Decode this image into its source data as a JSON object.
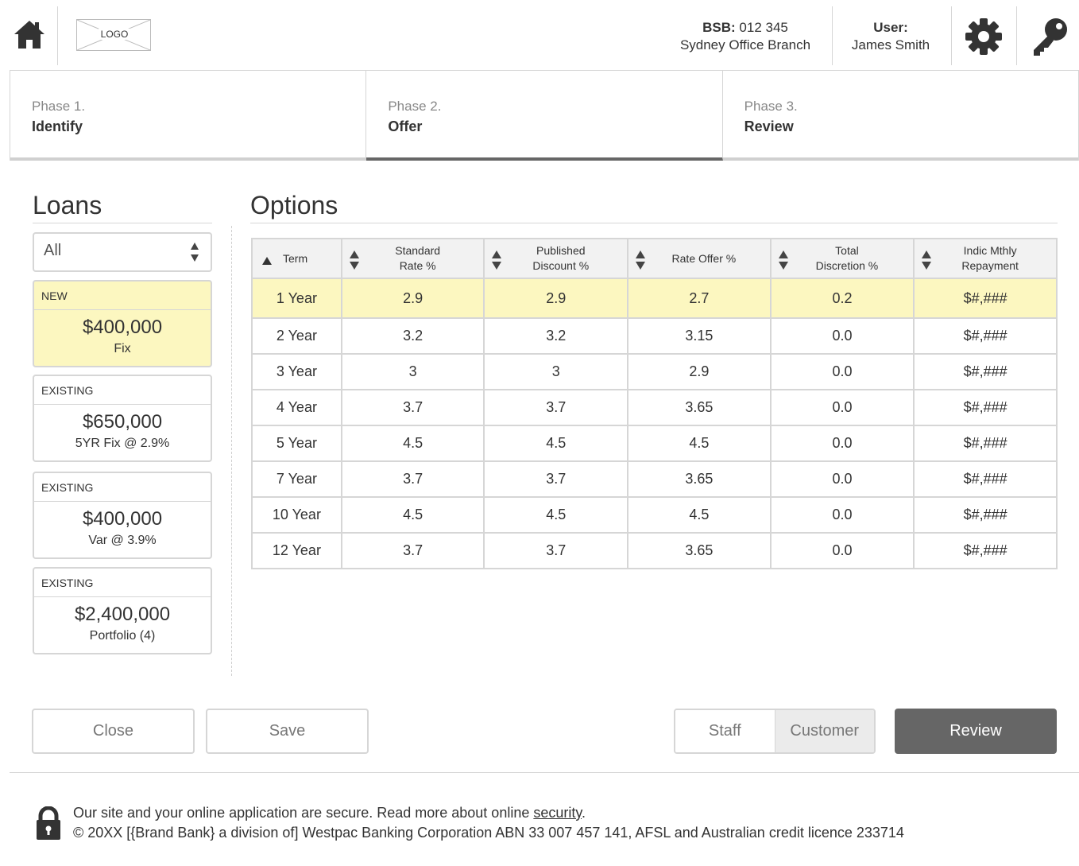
{
  "header": {
    "logo_text": "LOGO",
    "bsb_label": "BSB:",
    "bsb_value": "012 345",
    "branch": "Sydney Office Branch",
    "user_label": "User:",
    "user_name": "James Smith"
  },
  "phases": [
    {
      "num": "Phase 1.",
      "name": "Identify",
      "active": false
    },
    {
      "num": "Phase 2.",
      "name": "Offer",
      "active": true
    },
    {
      "num": "Phase 3.",
      "name": "Review",
      "active": false
    }
  ],
  "loans": {
    "title": "Loans",
    "filter_value": "All",
    "cards": [
      {
        "tag": "NEW",
        "amount": "$400,000",
        "desc": "Fix",
        "selected": true
      },
      {
        "tag": "EXISTING",
        "amount": "$650,000",
        "desc": "5YR Fix @ 2.9%",
        "selected": false
      },
      {
        "tag": "EXISTING",
        "amount": "$400,000",
        "desc": "Var @ 3.9%",
        "selected": false
      },
      {
        "tag": "EXISTING",
        "amount": "$2,400,000",
        "desc": "Portfolio (4)",
        "selected": false
      }
    ]
  },
  "options": {
    "title": "Options",
    "columns": [
      {
        "l1": "Term",
        "l2": ""
      },
      {
        "l1": "Standard",
        "l2": "Rate %"
      },
      {
        "l1": "Published",
        "l2": "Discount %"
      },
      {
        "l1": "Rate Offer %",
        "l2": ""
      },
      {
        "l1": "Total",
        "l2": "Discretion %"
      },
      {
        "l1": "Indic Mthly",
        "l2": "Repayment"
      }
    ],
    "rows": [
      [
        "1 Year",
        "2.9",
        "2.9",
        "2.7",
        "0.2",
        "$#,###"
      ],
      [
        "2 Year",
        "3.2",
        "3.2",
        "3.15",
        "0.0",
        "$#,###"
      ],
      [
        "3 Year",
        "3",
        "3",
        "2.9",
        "0.0",
        "$#,###"
      ],
      [
        "4 Year",
        "3.7",
        "3.7",
        "3.65",
        "0.0",
        "$#,###"
      ],
      [
        "5 Year",
        "4.5",
        "4.5",
        "4.5",
        "0.0",
        "$#,###"
      ],
      [
        "7 Year",
        "3.7",
        "3.7",
        "3.65",
        "0.0",
        "$#,###"
      ],
      [
        "10 Year",
        "4.5",
        "4.5",
        "4.5",
        "0.0",
        "$#,###"
      ],
      [
        "12 Year",
        "3.7",
        "3.7",
        "3.65",
        "0.0",
        "$#,###"
      ]
    ]
  },
  "buttons": {
    "close": "Close",
    "save": "Save",
    "staff": "Staff",
    "customer": "Customer",
    "review": "Review"
  },
  "footer": {
    "line1_prefix": "Our site and your online application are secure. Read more about online ",
    "line1_link": "security",
    "line1_suffix": ".",
    "line2": "© 20XX [{Brand Bank} a division of] Westpac Banking Corporation ABN 33 007 457 141, AFSL and Australian credit licence 233714"
  },
  "colors": {
    "highlight": "#fcf7c0",
    "review_button": "#666666",
    "border": "#d6d6d6"
  }
}
